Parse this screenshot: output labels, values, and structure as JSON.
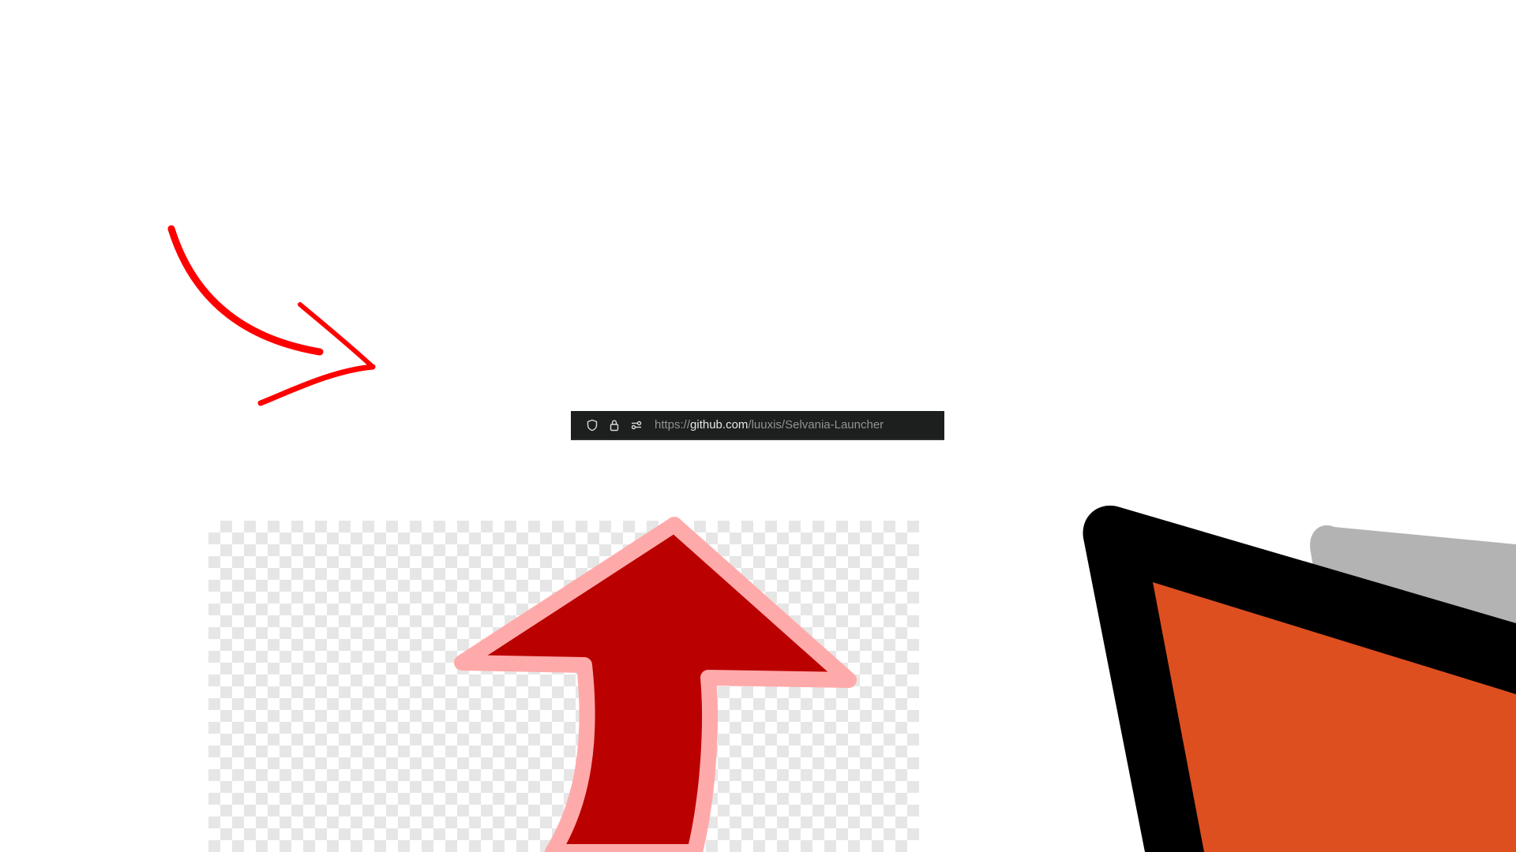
{
  "address_bar": {
    "url_scheme": "https://",
    "url_host": "github.com",
    "url_path": "/luuxis/Selvania-Launcher",
    "icons": [
      "shield-icon",
      "lock-icon",
      "permissions-icon"
    ]
  },
  "graphics": {
    "curved_arrow_color": "#ff0000",
    "up_arrow_fill": "#bb0000",
    "up_arrow_outline": "#ffaaaa",
    "box_fill": "#de4f20",
    "box_outline": "#000000",
    "box_shadow": "#b3b3b3"
  },
  "colors": {
    "urlbar_bg": "#1c1f1d",
    "url_dim": "#8e9591",
    "url_host": "#e6e8e6"
  }
}
